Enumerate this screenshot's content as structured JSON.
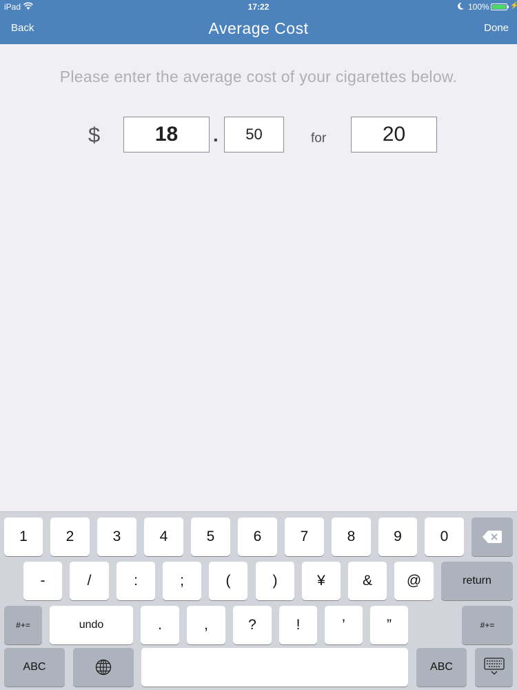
{
  "status_bar": {
    "device": "iPad",
    "time": "17:22",
    "battery": "100%"
  },
  "header": {
    "back_label": "Back",
    "title": "Average Cost",
    "done_label": "Done"
  },
  "form": {
    "instruction": "Please enter the average cost of your cigarettes below.",
    "currency_symbol": "$",
    "dollars": "18",
    "decimal_point": ".",
    "cents": "50",
    "for_label": "for",
    "pack_size": "20"
  },
  "keyboard": {
    "row1": [
      "1",
      "2",
      "3",
      "4",
      "5",
      "6",
      "7",
      "8",
      "9",
      "0"
    ],
    "backspace_icon": "backspace-icon",
    "row2": [
      "-",
      "/",
      ":",
      ";",
      "(",
      ")",
      "¥",
      "&",
      "@"
    ],
    "return_label": "return",
    "row3_left_label": "#+=",
    "undo_label": "undo",
    "row3": [
      ".",
      ",",
      "?",
      "!",
      "’",
      "”"
    ],
    "row3_right_label": "#+=",
    "abc_label": "ABC",
    "globe_icon": "globe-icon",
    "dismiss_icon": "keyboard-dismiss-icon"
  },
  "colors": {
    "header": "#4c83bd",
    "background": "#efeff4",
    "keyboard": "#d1d5db",
    "battery_fill": "#4cd964"
  }
}
